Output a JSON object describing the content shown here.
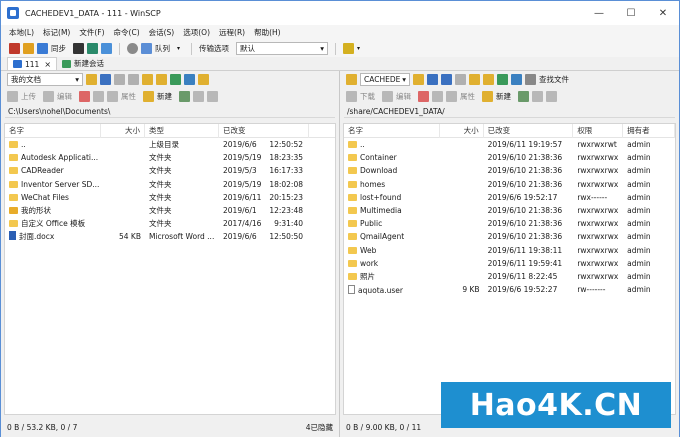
{
  "title": "CACHEDEV1_DATA - 111 - WinSCP",
  "window_controls": [
    "—",
    "☐",
    "✕"
  ],
  "menu": [
    "本地(L)",
    "标记(M)",
    "文件(F)",
    "命令(C)",
    "会话(S)",
    "选项(O)",
    "远程(R)",
    "帮助(H)"
  ],
  "toolbar": {
    "sync": "同步",
    "queue": "队列",
    "transfer_label": "传输选项",
    "transfer_value": "默认"
  },
  "tabs": {
    "session": "111",
    "new_session": "新建会话"
  },
  "local": {
    "location": "我的文档",
    "upload": "上传",
    "edit": "编辑",
    "properties": "属性",
    "new": "新建",
    "path": "C:\\Users\\nohel\\Documents\\",
    "columns": [
      "名字",
      "大小",
      "类型",
      "已改变"
    ],
    "rows": [
      {
        "name": "..",
        "size": "",
        "type": "上级目录",
        "date": "2019/6/6",
        "time": "12:50:52",
        "icon": "parent"
      },
      {
        "name": "Autodesk Applicati...",
        "size": "",
        "type": "文件夹",
        "date": "2019/5/19",
        "time": "18:23:35",
        "icon": "folder"
      },
      {
        "name": "CADReader",
        "size": "",
        "type": "文件夹",
        "date": "2019/5/3",
        "time": "16:17:33",
        "icon": "folder"
      },
      {
        "name": "Inventor Server SD...",
        "size": "",
        "type": "文件夹",
        "date": "2019/5/19",
        "time": "18:02:08",
        "icon": "folder"
      },
      {
        "name": "WeChat Files",
        "size": "",
        "type": "文件夹",
        "date": "2019/6/11",
        "time": "20:15:23",
        "icon": "folder"
      },
      {
        "name": "我的形状",
        "size": "",
        "type": "文件夹",
        "date": "2019/6/1",
        "time": "12:23:48",
        "icon": "special"
      },
      {
        "name": "自定义 Office 模板",
        "size": "",
        "type": "文件夹",
        "date": "2017/4/16",
        "time": "9:31:40",
        "icon": "folder"
      },
      {
        "name": "封面.docx",
        "size": "54 KB",
        "type": "Microsoft Word ...",
        "date": "2019/6/6",
        "time": "12:50:50",
        "icon": "docx"
      }
    ],
    "status_left": "0 B / 53.2 KB,   0 / 7",
    "status_right": "4已隐藏"
  },
  "remote": {
    "location": "CACHEDE",
    "download": "下载",
    "edit": "编辑",
    "properties": "属性",
    "new": "新建",
    "find": "查找文件",
    "path": "/share/CACHEDEV1_DATA/",
    "columns": [
      "名字",
      "大小",
      "已改变",
      "权限",
      "拥有者"
    ],
    "rows": [
      {
        "name": "..",
        "size": "",
        "changed": "2019/6/11 19:19:57",
        "perm": "rwxrwxrwt",
        "owner": "admin",
        "icon": "parent"
      },
      {
        "name": "Container",
        "size": "",
        "changed": "2019/6/10 21:38:36",
        "perm": "rwxrwxrwx",
        "owner": "admin",
        "icon": "folder"
      },
      {
        "name": "Download",
        "size": "",
        "changed": "2019/6/10 21:38:36",
        "perm": "rwxrwxrwx",
        "owner": "admin",
        "icon": "folder"
      },
      {
        "name": "homes",
        "size": "",
        "changed": "2019/6/10 21:38:36",
        "perm": "rwxrwxrwx",
        "owner": "admin",
        "icon": "folder"
      },
      {
        "name": "lost+found",
        "size": "",
        "changed": "2019/6/6 19:52:17",
        "perm": "rwx------",
        "owner": "admin",
        "icon": "folder"
      },
      {
        "name": "Multimedia",
        "size": "",
        "changed": "2019/6/10 21:38:36",
        "perm": "rwxrwxrwx",
        "owner": "admin",
        "icon": "folder"
      },
      {
        "name": "Public",
        "size": "",
        "changed": "2019/6/10 21:38:36",
        "perm": "rwxrwxrwx",
        "owner": "admin",
        "icon": "folder"
      },
      {
        "name": "QmailAgent",
        "size": "",
        "changed": "2019/6/10 21:38:36",
        "perm": "rwxrwxrwx",
        "owner": "admin",
        "icon": "folder"
      },
      {
        "name": "Web",
        "size": "",
        "changed": "2019/6/11 19:38:11",
        "perm": "rwxrwxrwx",
        "owner": "admin",
        "icon": "folder"
      },
      {
        "name": "work",
        "size": "",
        "changed": "2019/6/11 19:59:41",
        "perm": "rwxrwxrwx",
        "owner": "admin",
        "icon": "folder"
      },
      {
        "name": "照片",
        "size": "",
        "changed": "2019/6/11 8:22:45",
        "perm": "rwxrwxrwx",
        "owner": "admin",
        "icon": "folder"
      },
      {
        "name": "aquota.user",
        "size": "9 KB",
        "changed": "2019/6/6 19:52:27",
        "perm": "rw-------",
        "owner": "admin",
        "icon": "txt"
      }
    ],
    "status_left": "0 B / 9.00 KB,   0 / 11"
  },
  "watermark": "Hao4K.CN",
  "colors": {
    "folder": "#f3c84f",
    "accent": "#1e8fd0",
    "window_border": "#5a8fd6"
  }
}
